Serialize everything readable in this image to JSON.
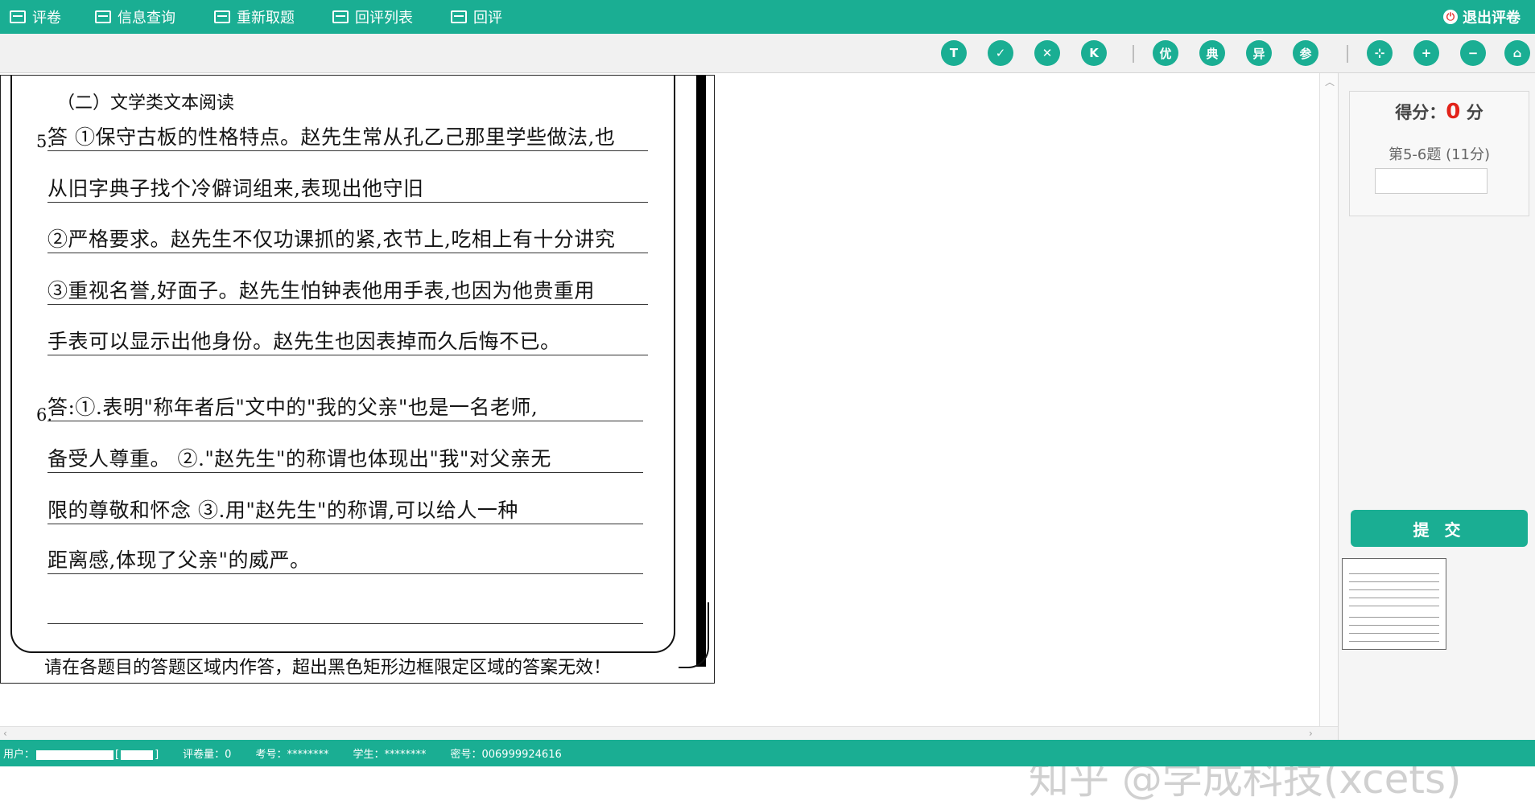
{
  "nav": {
    "items": [
      {
        "label": "评卷",
        "icon": "marking-icon"
      },
      {
        "label": "信息查询",
        "icon": "info-query-icon"
      },
      {
        "label": "重新取题",
        "icon": "refetch-icon"
      },
      {
        "label": "回评列表",
        "icon": "review-list-icon"
      },
      {
        "label": "回评",
        "icon": "review-icon"
      }
    ],
    "logout_label": "退出评卷",
    "logout_icon": "power-icon"
  },
  "toolbar": {
    "buttons": [
      {
        "glyph": "T",
        "name": "text-tool"
      },
      {
        "glyph": "✓",
        "name": "check-tool"
      },
      {
        "glyph": "✕",
        "name": "cross-tool"
      },
      {
        "glyph": "K",
        "name": "k-tool"
      },
      {
        "glyph": "优",
        "name": "excellent-tool"
      },
      {
        "glyph": "典",
        "name": "typical-tool"
      },
      {
        "glyph": "异",
        "name": "abnormal-tool"
      },
      {
        "glyph": "参",
        "name": "reference-tool"
      },
      {
        "glyph": "⊹",
        "name": "fit-tool"
      },
      {
        "glyph": "+",
        "name": "zoom-in-tool"
      },
      {
        "glyph": "−",
        "name": "zoom-out-tool"
      },
      {
        "glyph": "⌂",
        "name": "reset-tool"
      }
    ]
  },
  "sheet": {
    "section_title": "（二）文学类文本阅读",
    "q5_number": "5.",
    "q6_number": "6.",
    "answer_lines": [
      "答 ①保守古板的性格特点。赵先生常从孔乙己那里学些做法,也",
      "从旧字典子找个冷僻词组来,表现出他守旧",
      "②严格要求。赵先生不仅功课抓的紧,衣节上,吃相上有十分讲究",
      "③重视名誉,好面子。赵先生怕钟表他用手表,也因为他贵重用",
      "手表可以显示出他身份。赵先生也因表掉而久后悔不已。",
      "答:①.表明\"称年者后\"文中的\"我的父亲\"也是一名老师,",
      "备受人尊重。 ②.\"赵先生\"的称谓也体现出\"我\"对父亲无",
      "限的尊敬和怀念 ③.用\"赵先生\"的称谓,可以给人一种",
      "距离感,体现了父亲\"的威严。",
      ""
    ],
    "footer_notice": "请在各题目的答题区域内作答，超出黑色矩形边框限定区域的答案无效！"
  },
  "watermark": "知乎 @学成科技(xcets)",
  "panel": {
    "score_prefix": "得分：",
    "score_value": "0",
    "score_suffix": " 分",
    "question_label": "第5-6题 (11分)",
    "score_input_value": "",
    "submit_label": "提 交"
  },
  "status": {
    "user_label": "用户：",
    "user_bracket_open": "[",
    "user_bracket_close": "]",
    "marked_count": "评卷量：0",
    "exam_no": "考号：********",
    "student": "学生：********",
    "secret_no": "密号：006999924616"
  },
  "colors": {
    "brand": "#1aae93",
    "score_red": "#e2231a"
  }
}
